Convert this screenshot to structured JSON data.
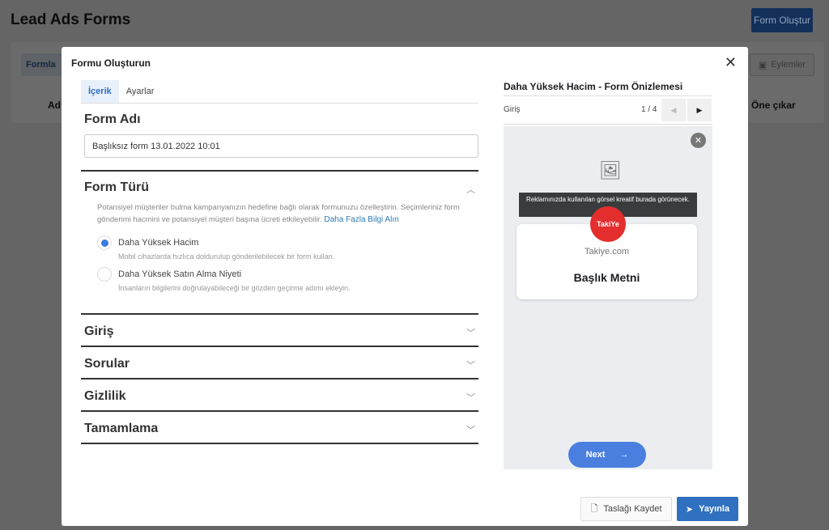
{
  "page": {
    "title": "Lead Ads Forms",
    "create_button": "Form Oluştur",
    "tab": "Formla",
    "actions": "Eylemler",
    "col_left": "Ad",
    "col_right": "Öne çıkar"
  },
  "modal": {
    "title": "Formu Oluşturun",
    "tabs": [
      {
        "label": "İçerik",
        "active": true
      },
      {
        "label": "Ayarlar",
        "active": false
      }
    ],
    "form_name": {
      "label": "Form Adı",
      "value": "Başlıksız form 13.01.2022 10:01"
    },
    "form_type": {
      "label": "Form Türü",
      "description": "Potansiyel müşteriler bulma kampanyanızın hedefine bağlı olarak formunuzu özelleştirin. Seçimleriniz form gönderimi hacmini ve potansiyel müşteri başına ücreti etkileyebilir.",
      "link": "Daha Fazla Bilgi Alın",
      "options": [
        {
          "label": "Daha Yüksek Hacim",
          "description": "Mobil cihazlarda hızlıca doldurulup gönderilebilecek bir form kullan.",
          "selected": true
        },
        {
          "label": "Daha Yüksek Satın Alma Niyeti",
          "description": "İnsanların bilgilerini doğrulayabileceği bir gözden geçirme adımı ekleyin.",
          "selected": false
        }
      ]
    },
    "sections": [
      "Giriş",
      "Sorular",
      "Gizlilik",
      "Tamamlama"
    ],
    "preview": {
      "title": "Daha Yüksek Hacim - Form Önizlemesi",
      "step": "Giriş",
      "page": "1 / 4",
      "tooltip": "Reklamınızda kullanılan görsel kreatif burada görünecek.",
      "logo": "TakiYe.com",
      "site": "Takiye.com",
      "headline": "Başlık Metni",
      "next": "Next"
    },
    "save_draft": "Taslağı Kaydet",
    "publish": "Yayınla"
  },
  "colors": {
    "primary": "#2f70c0",
    "radio": "#3a7be0",
    "logo": "#e42d2d"
  }
}
